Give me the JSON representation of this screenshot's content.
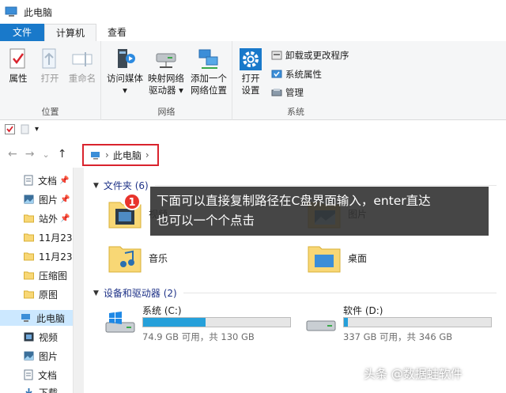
{
  "window": {
    "title": "此电脑"
  },
  "tabs": [
    {
      "label": "文件"
    },
    {
      "label": "计算机"
    },
    {
      "label": "查看"
    }
  ],
  "ribbon": {
    "location_group": {
      "label": "位置",
      "properties": "属性",
      "open": "打开",
      "rename": "重命名"
    },
    "network_group": {
      "label": "网络",
      "access_media_l1": "访问媒体",
      "access_media_l2": "▾",
      "map_drive_l1": "映射网络",
      "map_drive_l2": "驱动器 ▾",
      "add_location_l1": "添加一个",
      "add_location_l2": "网络位置"
    },
    "system_group": {
      "label": "系统",
      "open_settings_l1": "打开",
      "open_settings_l2": "设置",
      "uninstall": "卸载或更改程序",
      "system_properties": "系统属性",
      "manage": "管理"
    }
  },
  "quick_access_toolbar": {
    "dropdown": "▾"
  },
  "navigation": {
    "back": "←",
    "forward": "→",
    "recent": "⌄",
    "up": "↑",
    "breadcrumb": {
      "location": "此电脑",
      "separator": "›",
      "chevron": "›"
    }
  },
  "nav_pane": [
    {
      "label": "文档",
      "pinned": true
    },
    {
      "label": "图片",
      "pinned": true
    },
    {
      "label": "站外",
      "pinned": true
    },
    {
      "label": "11月23"
    },
    {
      "label": "11月23"
    },
    {
      "label": "压缩图"
    },
    {
      "label": "原图"
    },
    {
      "label": "此电脑",
      "selected": true
    },
    {
      "label": "视频"
    },
    {
      "label": "图片"
    },
    {
      "label": "文档"
    },
    {
      "label": "下载"
    }
  ],
  "pin_glyph": "📌",
  "content": {
    "folders_header": "文件夹 (6)",
    "folders": [
      {
        "label": "视频"
      },
      {
        "label": "图片"
      },
      {
        "label": "音乐"
      },
      {
        "label": "桌面"
      }
    ],
    "drives_header": "设备和驱动器 (2)",
    "drives": [
      {
        "name": "系统 (C:)",
        "info": "74.9 GB 可用，共 130 GB",
        "used_fraction": 0.424
      },
      {
        "name": "软件 (D:)",
        "info": "337 GB 可用，共 346 GB",
        "used_fraction": 0.026
      }
    ]
  },
  "tooltip": {
    "badge": "1",
    "line1": "下面可以直接复制路径在C盘界面输入，enter直达",
    "line2": "也可以一个个点击"
  },
  "watermark": "头条 @数据蛙软件",
  "colors": {
    "accent": "#1979ca",
    "highlight_border": "#d9232d",
    "drive_bar": "#26a0da",
    "selected_bg": "#cce8ff"
  }
}
